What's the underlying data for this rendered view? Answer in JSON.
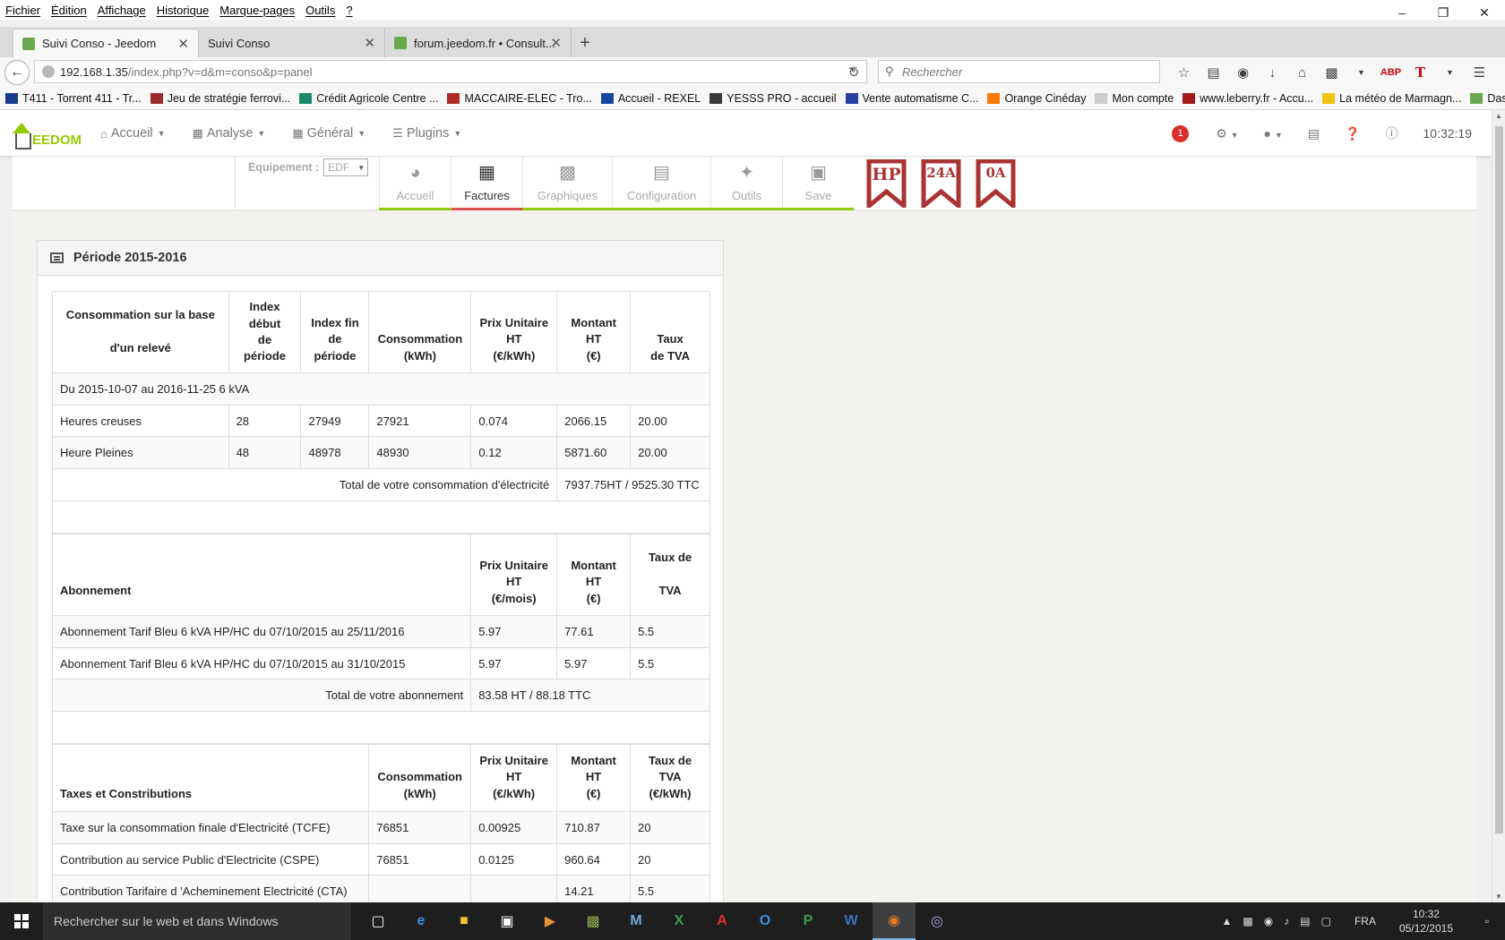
{
  "menubar": [
    "Fichier",
    "Édition",
    "Affichage",
    "Historique",
    "Marque-pages",
    "Outils",
    "?"
  ],
  "tabs": [
    {
      "label": "Suivi Conso - Jeedom",
      "active": true
    },
    {
      "label": "Suivi Conso",
      "active": false
    },
    {
      "label": "forum.jeedom.fr • Consult...",
      "active": false
    }
  ],
  "url": {
    "host": "192.168.1.35",
    "path": "/index.php?v=d&m=conso&p=panel"
  },
  "search": {
    "placeholder": "Rechercher"
  },
  "bookmarks": [
    "T411 - Torrent 411 - Tr...",
    "Jeu de stratégie ferrovi...",
    "Crédit Agricole Centre ...",
    "MACCAIRE-ELEC - Tro...",
    "Accueil - REXEL",
    "YESSS PRO - accueil",
    "Vente automatisme C...",
    "Orange Cinéday",
    "Mon compte",
    "www.leberry.fr - Accu...",
    "La météo de Marmagn...",
    "Dashboard - Jeedom"
  ],
  "jeedom": {
    "logo_text": "EEDOM",
    "menu": [
      "Accueil",
      "Analyse",
      "Général",
      "Plugins"
    ],
    "badge": "1",
    "time": "10:32:19"
  },
  "plugin": {
    "equip_label": "Equipement :",
    "equip_value": "EDF",
    "tabs": [
      {
        "label": "Accueil",
        "active": false
      },
      {
        "label": "Factures",
        "active": true
      },
      {
        "label": "Graphiques",
        "active": false
      },
      {
        "label": "Configuration",
        "active": false
      },
      {
        "label": "Outils",
        "active": false
      },
      {
        "label": "Save",
        "active": false
      }
    ],
    "flags": [
      "HP",
      "24A",
      "0A"
    ]
  },
  "panel": {
    "title": "Période 2015-2016",
    "conso": {
      "headers": {
        "c0a": "Consommation sur la base",
        "c0b": "d'un relevé",
        "c1": [
          "Index",
          "début",
          "de",
          "période"
        ],
        "c2": [
          "Index fin",
          "de",
          "période"
        ],
        "c3": [
          "Consommation",
          "(kWh)"
        ],
        "c4": [
          "Prix Unitaire",
          "HT",
          "(€/kWh)"
        ],
        "c5": [
          "Montant",
          "HT",
          "(€)"
        ],
        "c6": [
          "Taux",
          "de TVA"
        ]
      },
      "period": "Du 2015-10-07 au 2016-11-25 6 kVA",
      "rows": [
        {
          "label": "Heures creuses",
          "idx_start": "28",
          "idx_end": "27949",
          "conso": "27921",
          "pu": "0.074",
          "montant": "2066.15",
          "tva": "20.00"
        },
        {
          "label": "Heure Pleines",
          "idx_start": "48",
          "idx_end": "48978",
          "conso": "48930",
          "pu": "0.12",
          "montant": "5871.60",
          "tva": "20.00"
        }
      ],
      "total_label": "Total de votre consommation d'électricité",
      "total_value": "7937.75HT / 9525.30 TTC"
    },
    "abonnement": {
      "headers": {
        "c0": "Abonnement",
        "c1": [
          "Prix Unitaire",
          "HT",
          "(€/mois)"
        ],
        "c2": [
          "Montant",
          "HT",
          "(€)"
        ],
        "c3a": "Taux de",
        "c3b": "TVA"
      },
      "rows": [
        {
          "label": "Abonnement Tarif Bleu 6 kVA HP/HC du 07/10/2015 au 25/11/2016",
          "pu": "5.97",
          "montant": "77.61",
          "tva": "5.5"
        },
        {
          "label": "Abonnement Tarif Bleu 6 kVA HP/HC du 07/10/2015 au 31/10/2015",
          "pu": "5.97",
          "montant": "5.97",
          "tva": "5.5"
        }
      ],
      "total_label": "Total de votre abonnement",
      "total_value": "83.58 HT / 88.18 TTC"
    },
    "taxes": {
      "headers": {
        "c0": "Taxes et Constributions",
        "c1": [
          "Consommation",
          "(kWh)"
        ],
        "c2": [
          "Prix Unitaire",
          "HT",
          "(€/kWh)"
        ],
        "c3": [
          "Montant",
          "HT",
          "(€)"
        ],
        "c4": [
          "Taux de",
          "TVA",
          "(€/kWh)"
        ]
      },
      "rows": [
        {
          "label": "Taxe sur la consommation finale d'Electricité (TCFE)",
          "conso": "76851",
          "pu": "0.00925",
          "montant": "710.87",
          "tva": "20"
        },
        {
          "label": "Contribution au service Public d'Electricite (CSPE)",
          "conso": "76851",
          "pu": "0.0125",
          "montant": "960.64",
          "tva": "20"
        },
        {
          "label": "Contribution Tarifaire d 'Acheminement Electricité (CTA)",
          "conso": "",
          "pu": "",
          "montant": "14.21",
          "tva": "5.5"
        }
      ]
    }
  },
  "taskbar": {
    "search_placeholder": "Rechercher sur le web et dans Windows",
    "lang": "FRA",
    "time": "10:32",
    "date": "05/12/2015"
  }
}
